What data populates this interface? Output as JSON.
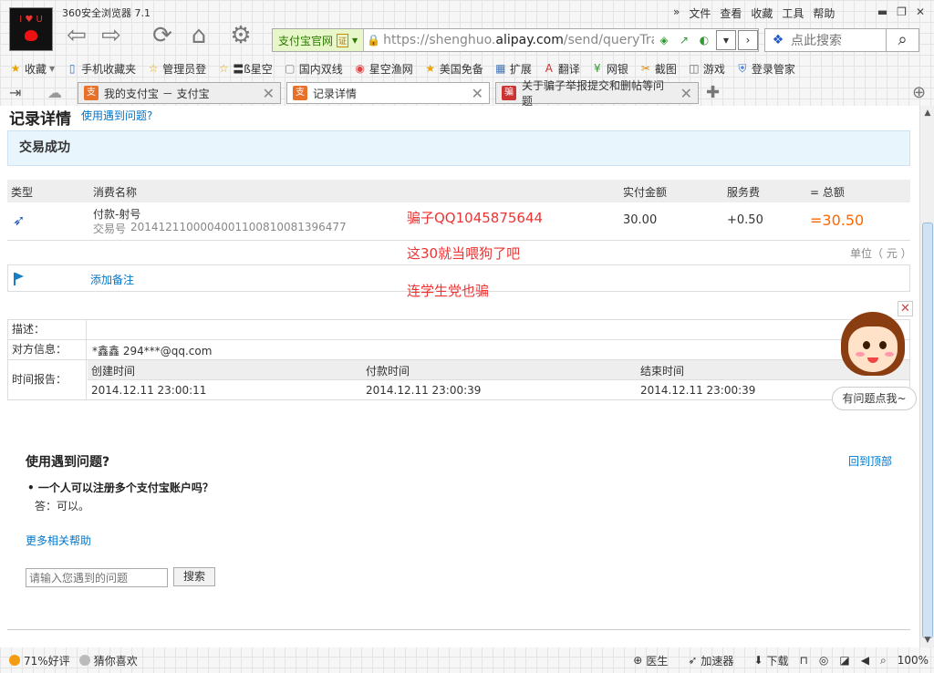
{
  "browser": {
    "app_title": "360安全浏览器 7.1",
    "menus": [
      "文件",
      "查看",
      "收藏",
      "工具",
      "帮助"
    ],
    "avatar_text": "I ♥ U",
    "address": {
      "site_badge": "支付宝官网",
      "cert": "证",
      "url_prefix": "https://shenghuo.",
      "url_domain": "alipay.com",
      "url_suffix": "/send/queryTran"
    },
    "search_placeholder": "点此搜索"
  },
  "favorites": [
    {
      "icon": "star-icon",
      "label": "收藏"
    },
    {
      "icon": "phone-icon",
      "label": "手机收藏夹"
    },
    {
      "icon": "star-icon",
      "label": "管理员登"
    },
    {
      "icon": "star-icon",
      "label": "〓ß星空"
    },
    {
      "icon": "page-icon",
      "label": "国内双线"
    },
    {
      "icon": "globe-icon",
      "label": "星空渔网"
    },
    {
      "icon": "star-icon",
      "label": "美国免备"
    },
    {
      "icon": "grid-icon",
      "label": "扩展"
    },
    {
      "icon": "translate-icon",
      "label": "翻译"
    },
    {
      "icon": "yen-icon",
      "label": "网银"
    },
    {
      "icon": "scissors-icon",
      "label": "截图"
    },
    {
      "icon": "gamepad-icon",
      "label": "游戏"
    },
    {
      "icon": "shield-icon",
      "label": "登录管家"
    }
  ],
  "tabs": [
    {
      "title": "我的支付宝 － 支付宝",
      "active": false
    },
    {
      "title": "记录详情",
      "active": true
    },
    {
      "title": "关于骗子举报提交和删帖等问题",
      "active": false
    }
  ],
  "page": {
    "title": "记录详情",
    "help_link": "使用遇到问题?",
    "status": "交易成功",
    "table_headers": {
      "type": "类型",
      "name": "消费名称",
      "amount": "实付金额",
      "fee": "服务费",
      "total": "= 总额"
    },
    "record": {
      "name": "付款-射号",
      "trade_no_label": "交易号",
      "trade_no": "2014121100004001100810081396477",
      "amount": "30.00",
      "fee": "+0.50",
      "total": "=30.50"
    },
    "unit": "单位（ 元 ）",
    "add_remark": "添加备注",
    "annotations": [
      "骗子QQ1045875644",
      "这30就当喂狗了吧",
      "连学生党也骗"
    ],
    "info": {
      "desc_label": "描述：",
      "counterparty_label": "对方信息：",
      "counterparty": "*鑫鑫 294***@qq.com",
      "time_label": "时间报告：",
      "created_label": "创建时间",
      "paid_label": "付款时间",
      "finished_label": "结束时间",
      "created": "2014.12.11 23:00:11",
      "paid": "2014.12.11 23:00:39",
      "finished": "2014.12.11 23:00:39"
    },
    "assistant_label": "有问题点我~",
    "faq": {
      "title": "使用遇到问题?",
      "back_top": "回到顶部",
      "question": "• 一个人可以注册多个支付宝账户吗？",
      "answer": "答：可以。",
      "more": "更多相关帮助",
      "search_placeholder": "请输入您遇到的问题",
      "search_button": "搜索"
    }
  },
  "statusbar": {
    "rating": "71%好评",
    "guess": "猜你喜欢",
    "doctor": "医生",
    "accelerator": "加速器",
    "download": "下载",
    "zoom": "100%"
  },
  "colors": {
    "link": "#0077cc",
    "success_bg": "#e9f5fd",
    "total": "#ff6600",
    "annotation": "#ee3333"
  }
}
